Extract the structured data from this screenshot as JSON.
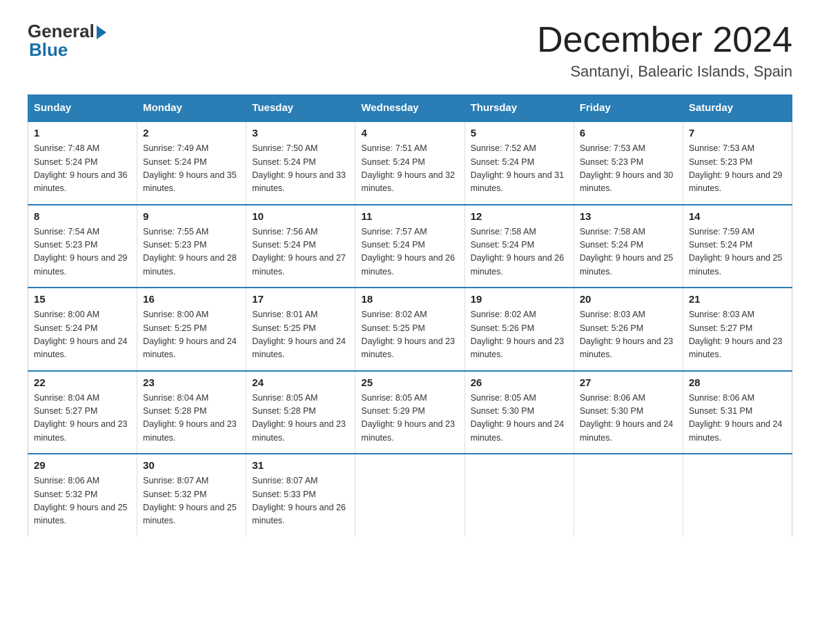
{
  "logo": {
    "general": "General",
    "blue": "Blue"
  },
  "title": "December 2024",
  "location": "Santanyi, Balearic Islands, Spain",
  "weekdays": [
    "Sunday",
    "Monday",
    "Tuesday",
    "Wednesday",
    "Thursday",
    "Friday",
    "Saturday"
  ],
  "weeks": [
    [
      {
        "day": "1",
        "sunrise": "7:48 AM",
        "sunset": "5:24 PM",
        "daylight": "9 hours and 36 minutes."
      },
      {
        "day": "2",
        "sunrise": "7:49 AM",
        "sunset": "5:24 PM",
        "daylight": "9 hours and 35 minutes."
      },
      {
        "day": "3",
        "sunrise": "7:50 AM",
        "sunset": "5:24 PM",
        "daylight": "9 hours and 33 minutes."
      },
      {
        "day": "4",
        "sunrise": "7:51 AM",
        "sunset": "5:24 PM",
        "daylight": "9 hours and 32 minutes."
      },
      {
        "day": "5",
        "sunrise": "7:52 AM",
        "sunset": "5:24 PM",
        "daylight": "9 hours and 31 minutes."
      },
      {
        "day": "6",
        "sunrise": "7:53 AM",
        "sunset": "5:23 PM",
        "daylight": "9 hours and 30 minutes."
      },
      {
        "day": "7",
        "sunrise": "7:53 AM",
        "sunset": "5:23 PM",
        "daylight": "9 hours and 29 minutes."
      }
    ],
    [
      {
        "day": "8",
        "sunrise": "7:54 AM",
        "sunset": "5:23 PM",
        "daylight": "9 hours and 29 minutes."
      },
      {
        "day": "9",
        "sunrise": "7:55 AM",
        "sunset": "5:23 PM",
        "daylight": "9 hours and 28 minutes."
      },
      {
        "day": "10",
        "sunrise": "7:56 AM",
        "sunset": "5:24 PM",
        "daylight": "9 hours and 27 minutes."
      },
      {
        "day": "11",
        "sunrise": "7:57 AM",
        "sunset": "5:24 PM",
        "daylight": "9 hours and 26 minutes."
      },
      {
        "day": "12",
        "sunrise": "7:58 AM",
        "sunset": "5:24 PM",
        "daylight": "9 hours and 26 minutes."
      },
      {
        "day": "13",
        "sunrise": "7:58 AM",
        "sunset": "5:24 PM",
        "daylight": "9 hours and 25 minutes."
      },
      {
        "day": "14",
        "sunrise": "7:59 AM",
        "sunset": "5:24 PM",
        "daylight": "9 hours and 25 minutes."
      }
    ],
    [
      {
        "day": "15",
        "sunrise": "8:00 AM",
        "sunset": "5:24 PM",
        "daylight": "9 hours and 24 minutes."
      },
      {
        "day": "16",
        "sunrise": "8:00 AM",
        "sunset": "5:25 PM",
        "daylight": "9 hours and 24 minutes."
      },
      {
        "day": "17",
        "sunrise": "8:01 AM",
        "sunset": "5:25 PM",
        "daylight": "9 hours and 24 minutes."
      },
      {
        "day": "18",
        "sunrise": "8:02 AM",
        "sunset": "5:25 PM",
        "daylight": "9 hours and 23 minutes."
      },
      {
        "day": "19",
        "sunrise": "8:02 AM",
        "sunset": "5:26 PM",
        "daylight": "9 hours and 23 minutes."
      },
      {
        "day": "20",
        "sunrise": "8:03 AM",
        "sunset": "5:26 PM",
        "daylight": "9 hours and 23 minutes."
      },
      {
        "day": "21",
        "sunrise": "8:03 AM",
        "sunset": "5:27 PM",
        "daylight": "9 hours and 23 minutes."
      }
    ],
    [
      {
        "day": "22",
        "sunrise": "8:04 AM",
        "sunset": "5:27 PM",
        "daylight": "9 hours and 23 minutes."
      },
      {
        "day": "23",
        "sunrise": "8:04 AM",
        "sunset": "5:28 PM",
        "daylight": "9 hours and 23 minutes."
      },
      {
        "day": "24",
        "sunrise": "8:05 AM",
        "sunset": "5:28 PM",
        "daylight": "9 hours and 23 minutes."
      },
      {
        "day": "25",
        "sunrise": "8:05 AM",
        "sunset": "5:29 PM",
        "daylight": "9 hours and 23 minutes."
      },
      {
        "day": "26",
        "sunrise": "8:05 AM",
        "sunset": "5:30 PM",
        "daylight": "9 hours and 24 minutes."
      },
      {
        "day": "27",
        "sunrise": "8:06 AM",
        "sunset": "5:30 PM",
        "daylight": "9 hours and 24 minutes."
      },
      {
        "day": "28",
        "sunrise": "8:06 AM",
        "sunset": "5:31 PM",
        "daylight": "9 hours and 24 minutes."
      }
    ],
    [
      {
        "day": "29",
        "sunrise": "8:06 AM",
        "sunset": "5:32 PM",
        "daylight": "9 hours and 25 minutes."
      },
      {
        "day": "30",
        "sunrise": "8:07 AM",
        "sunset": "5:32 PM",
        "daylight": "9 hours and 25 minutes."
      },
      {
        "day": "31",
        "sunrise": "8:07 AM",
        "sunset": "5:33 PM",
        "daylight": "9 hours and 26 minutes."
      },
      null,
      null,
      null,
      null
    ]
  ],
  "labels": {
    "sunrise_prefix": "Sunrise: ",
    "sunset_prefix": "Sunset: ",
    "daylight_prefix": "Daylight: "
  }
}
